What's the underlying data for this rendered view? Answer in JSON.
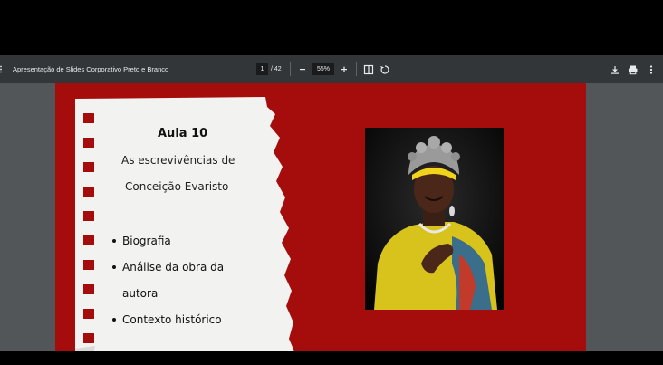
{
  "pdf_viewer": {
    "document_title": "Apresentação de Slides Corporativo Preto e Branco",
    "current_page": "1",
    "total_pages": "/ 42",
    "zoom_level": "55%",
    "zoom_out_icon": "minus-icon",
    "zoom_in_icon": "plus-icon",
    "menu_icon": "hamburger-icon",
    "fit_icon": "fit-page-icon",
    "rotate_icon": "rotate-icon",
    "download_icon": "download-icon",
    "print_icon": "print-icon",
    "more_icon": "more-vert-icon"
  },
  "slide": {
    "title": "Aula 10",
    "subtitle_line1": "As escrevivências de",
    "subtitle_line2": "Conceição Evaristo",
    "bullets": [
      {
        "text": "Biografia"
      },
      {
        "text": "Análise da obra da"
      },
      {
        "text": "autora"
      },
      {
        "text": "Contexto histórico"
      }
    ],
    "photo_alt": "portrait-photo"
  },
  "colors": {
    "slide_background": "#a50d0d",
    "toolbar": "#323639",
    "viewer_background": "#525659",
    "paper": "#f2f2f0"
  }
}
